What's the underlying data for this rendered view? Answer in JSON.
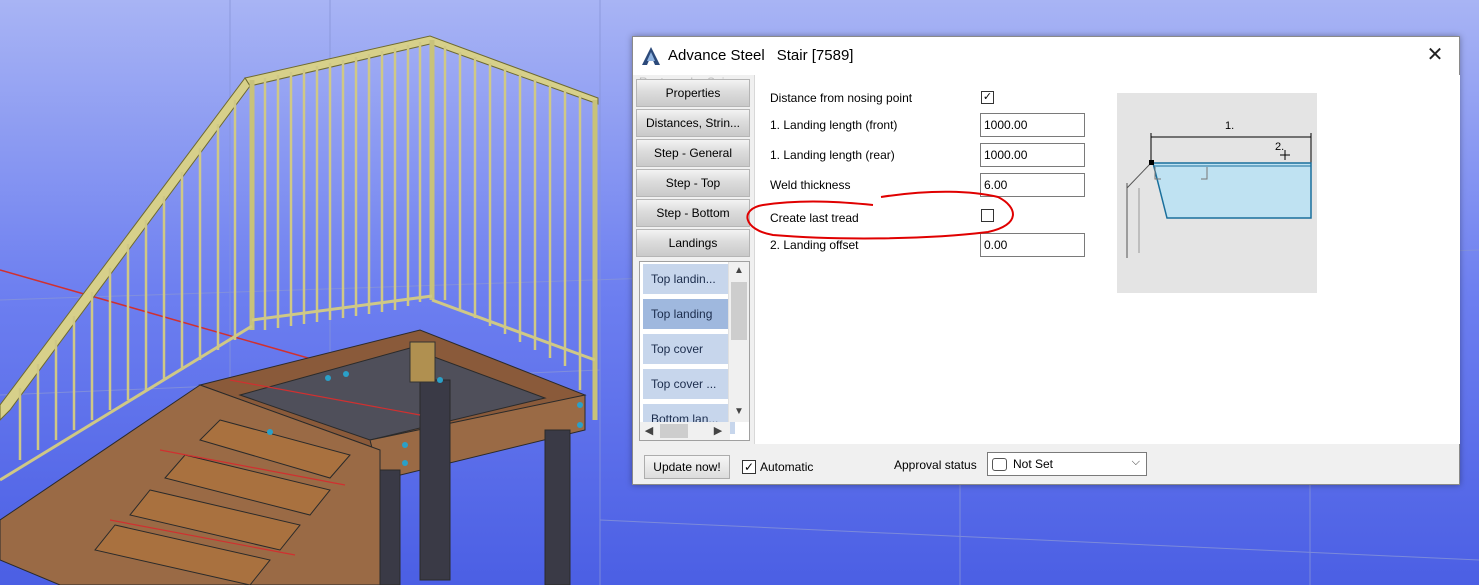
{
  "window": {
    "app_name": "Advance Steel",
    "title": "Stair [7589]",
    "close_label": "✕"
  },
  "nav": {
    "watermark": "Rectangular Snip",
    "buttons": [
      {
        "label": "Properties"
      },
      {
        "label": "Distances, Strin..."
      },
      {
        "label": "Step - General"
      },
      {
        "label": "Step - Top"
      },
      {
        "label": "Step - Bottom"
      },
      {
        "label": "Landings"
      }
    ],
    "sublist": [
      {
        "label": "Top landin..."
      },
      {
        "label": "Top landing",
        "selected": true
      },
      {
        "label": "Top cover"
      },
      {
        "label": "Top cover ..."
      },
      {
        "label": "Bottom lan..."
      }
    ]
  },
  "form": {
    "rows": [
      {
        "label": "Distance from nosing point",
        "type": "checkbox",
        "checked": true
      },
      {
        "label": "1. Landing length (front)",
        "type": "text",
        "value": "1000.00"
      },
      {
        "label": "1. Landing length (rear)",
        "type": "text",
        "value": "1000.00"
      },
      {
        "label": "Weld thickness",
        "type": "text",
        "value": "6.00"
      },
      {
        "label": "Create last tread",
        "type": "checkbox",
        "checked": false
      },
      {
        "label": "2. Landing offset",
        "type": "text",
        "value": "0.00"
      }
    ],
    "check_mark": "✓"
  },
  "diagram": {
    "label1": "1.",
    "label2": "2."
  },
  "footer": {
    "update_label": "Update now!",
    "automatic_label": "Automatic",
    "automatic_checked": true,
    "approval_label": "Approval status",
    "approval_value": "Not Set"
  },
  "colors": {
    "viewport_bg": "#5468e6",
    "annotation_red": "#e00000",
    "selection_blue": "#9fb8de"
  }
}
